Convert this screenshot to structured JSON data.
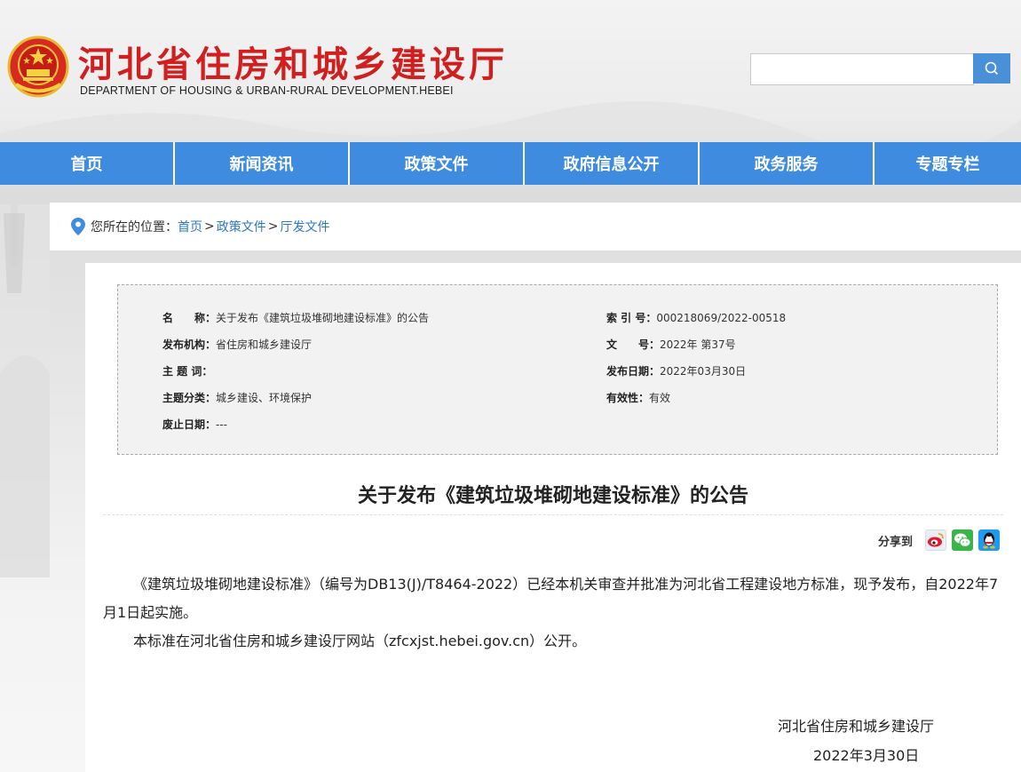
{
  "header": {
    "title": "河北省住房和城乡建设厅",
    "subtitle": "DEPARTMENT OF HOUSING & URBAN-RURAL DEVELOPMENT.HEBEI",
    "search": {
      "placeholder": "",
      "value": ""
    }
  },
  "nav": {
    "items": [
      {
        "label": "首页"
      },
      {
        "label": "新闻资讯"
      },
      {
        "label": "政策文件"
      },
      {
        "label": "政府信息公开"
      },
      {
        "label": "政务服务"
      },
      {
        "label": "专题专栏"
      }
    ]
  },
  "breadcrumb": {
    "prefix": "您所在的位置：",
    "items": [
      "首页",
      "政策文件",
      "厅发文件"
    ],
    "separator": ">"
  },
  "meta": {
    "name_label": "名　　称：",
    "name_value": "关于发布《建筑垃圾堆砌地建设标准》的公告",
    "index_label": "索 引 号：",
    "index_value": "000218069/2022-00518",
    "org_label": "发布机构：",
    "org_value": "省住房和城乡建设厅",
    "doc_label": "文　　号：",
    "doc_value": "2022年 第37号",
    "keyword_label": "主 题 词：",
    "keyword_value": "",
    "date_label": "发布日期：",
    "date_value": "2022年03月30日",
    "category_label": "主题分类：",
    "category_value": "城乡建设、环境保护",
    "validity_label": "有效性：",
    "validity_value": "有效",
    "abolish_label": "废止日期：",
    "abolish_value": "---"
  },
  "article": {
    "title": "关于发布《建筑垃圾堆砌地建设标准》的公告",
    "share_label": "分享到",
    "paragraphs": [
      "《建筑垃圾堆砌地建设标准》（编号为DB13(J)/T8464-2022）已经本机关审查并批准为河北省工程建设地方标准，现予发布，自2022年7月1日起实施。",
      "本标准在河北省住房和城乡建设厅网站（zfcxjst.hebei.gov.cn）公开。"
    ],
    "sign_org": "河北省住房和城乡建设厅",
    "sign_date": "2022年3月30日"
  },
  "icons": {
    "search": "search-icon",
    "location": "location-pin-icon",
    "weibo": "weibo-icon",
    "wechat": "wechat-icon",
    "qq": "qq-icon",
    "emblem": "national-emblem-icon"
  },
  "colors": {
    "brand_red": "#d11f1f",
    "nav_blue": "#3e8be0",
    "link_blue": "#2b78c9"
  }
}
